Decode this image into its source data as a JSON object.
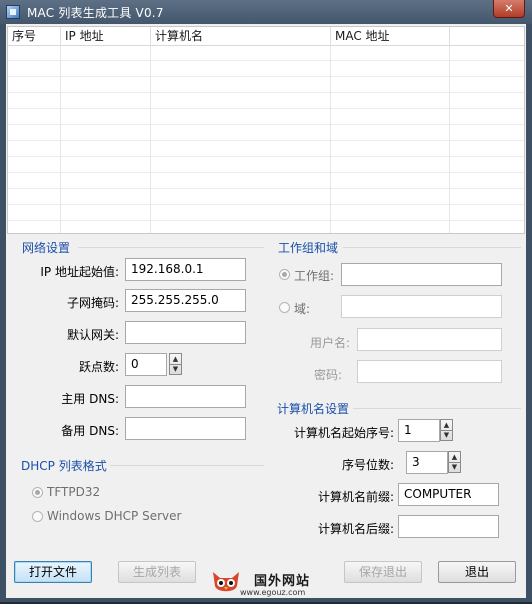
{
  "window": {
    "title": "MAC 列表生成工具 V0.7",
    "close_glyph": "✕"
  },
  "list": {
    "columns": [
      "序号",
      "IP 地址",
      "计算机名",
      "MAC 地址"
    ],
    "rows": []
  },
  "network": {
    "group_title": "网络设置",
    "ip_start_label": "IP 地址起始值:",
    "ip_start_value": "192.168.0.1",
    "subnet_label": "子网掩码:",
    "subnet_value": "255.255.255.0",
    "gateway_label": "默认网关:",
    "gateway_value": "",
    "hops_label": "跃点数:",
    "hops_value": "0",
    "dns_primary_label": "主用 DNS:",
    "dns_primary_value": "",
    "dns_backup_label": "备用 DNS:",
    "dns_backup_value": ""
  },
  "dhcp": {
    "group_title": "DHCP 列表格式",
    "options": [
      {
        "label": "TFTPD32",
        "selected": true
      },
      {
        "label": "Windows DHCP Server",
        "selected": false
      }
    ]
  },
  "workgroup": {
    "group_title": "工作组和域",
    "workgroup_label": "工作组:",
    "workgroup_value": "",
    "domain_label": "域:",
    "domain_value": "",
    "username_label": "用户名:",
    "username_value": "",
    "password_label": "密码:",
    "password_value": ""
  },
  "computer_name": {
    "group_title": "计算机名设置",
    "start_number_label": "计算机名起始序号:",
    "start_number_value": "1",
    "digits_label": "序号位数:",
    "digits_value": "3",
    "prefix_label": "计算机名前缀:",
    "prefix_value": "COMPUTER",
    "suffix_label": "计算机名后缀:",
    "suffix_value": ""
  },
  "buttons": {
    "open_file": "打开文件",
    "generate_list": "生成列表",
    "save_exit": "保存退出",
    "exit": "退出"
  },
  "watermark": {
    "text": "国外网站",
    "url": "www.egouz.com"
  },
  "colors": {
    "group_title": "#1a4fa8",
    "title_bar": "#4e6279",
    "focus_button": "#c3e2f6"
  },
  "icons": {
    "app": "app-icon",
    "close": "close-icon",
    "spin_up": "up-arrow-icon",
    "spin_down": "down-arrow-icon"
  }
}
